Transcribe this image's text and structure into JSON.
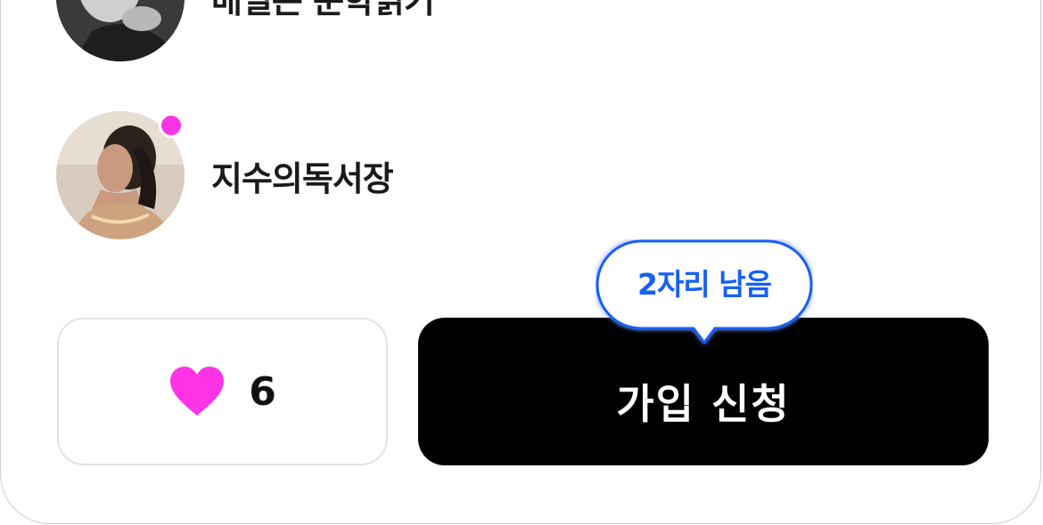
{
  "members": [
    {
      "name": "매일은 문학읽기",
      "online": false,
      "avatar": "avatar-man-bw"
    },
    {
      "name": "지수의독서장",
      "online": true,
      "avatar": "avatar-woman-photo"
    }
  ],
  "actions": {
    "like_icon": "heart-icon",
    "like_count": "6",
    "join_label": "가입 신청",
    "seats_remaining": "2자리 남음"
  },
  "colors": {
    "accent_pink": "#ff33e6",
    "tooltip_blue": "#1560f5",
    "join_bg": "#000000"
  }
}
